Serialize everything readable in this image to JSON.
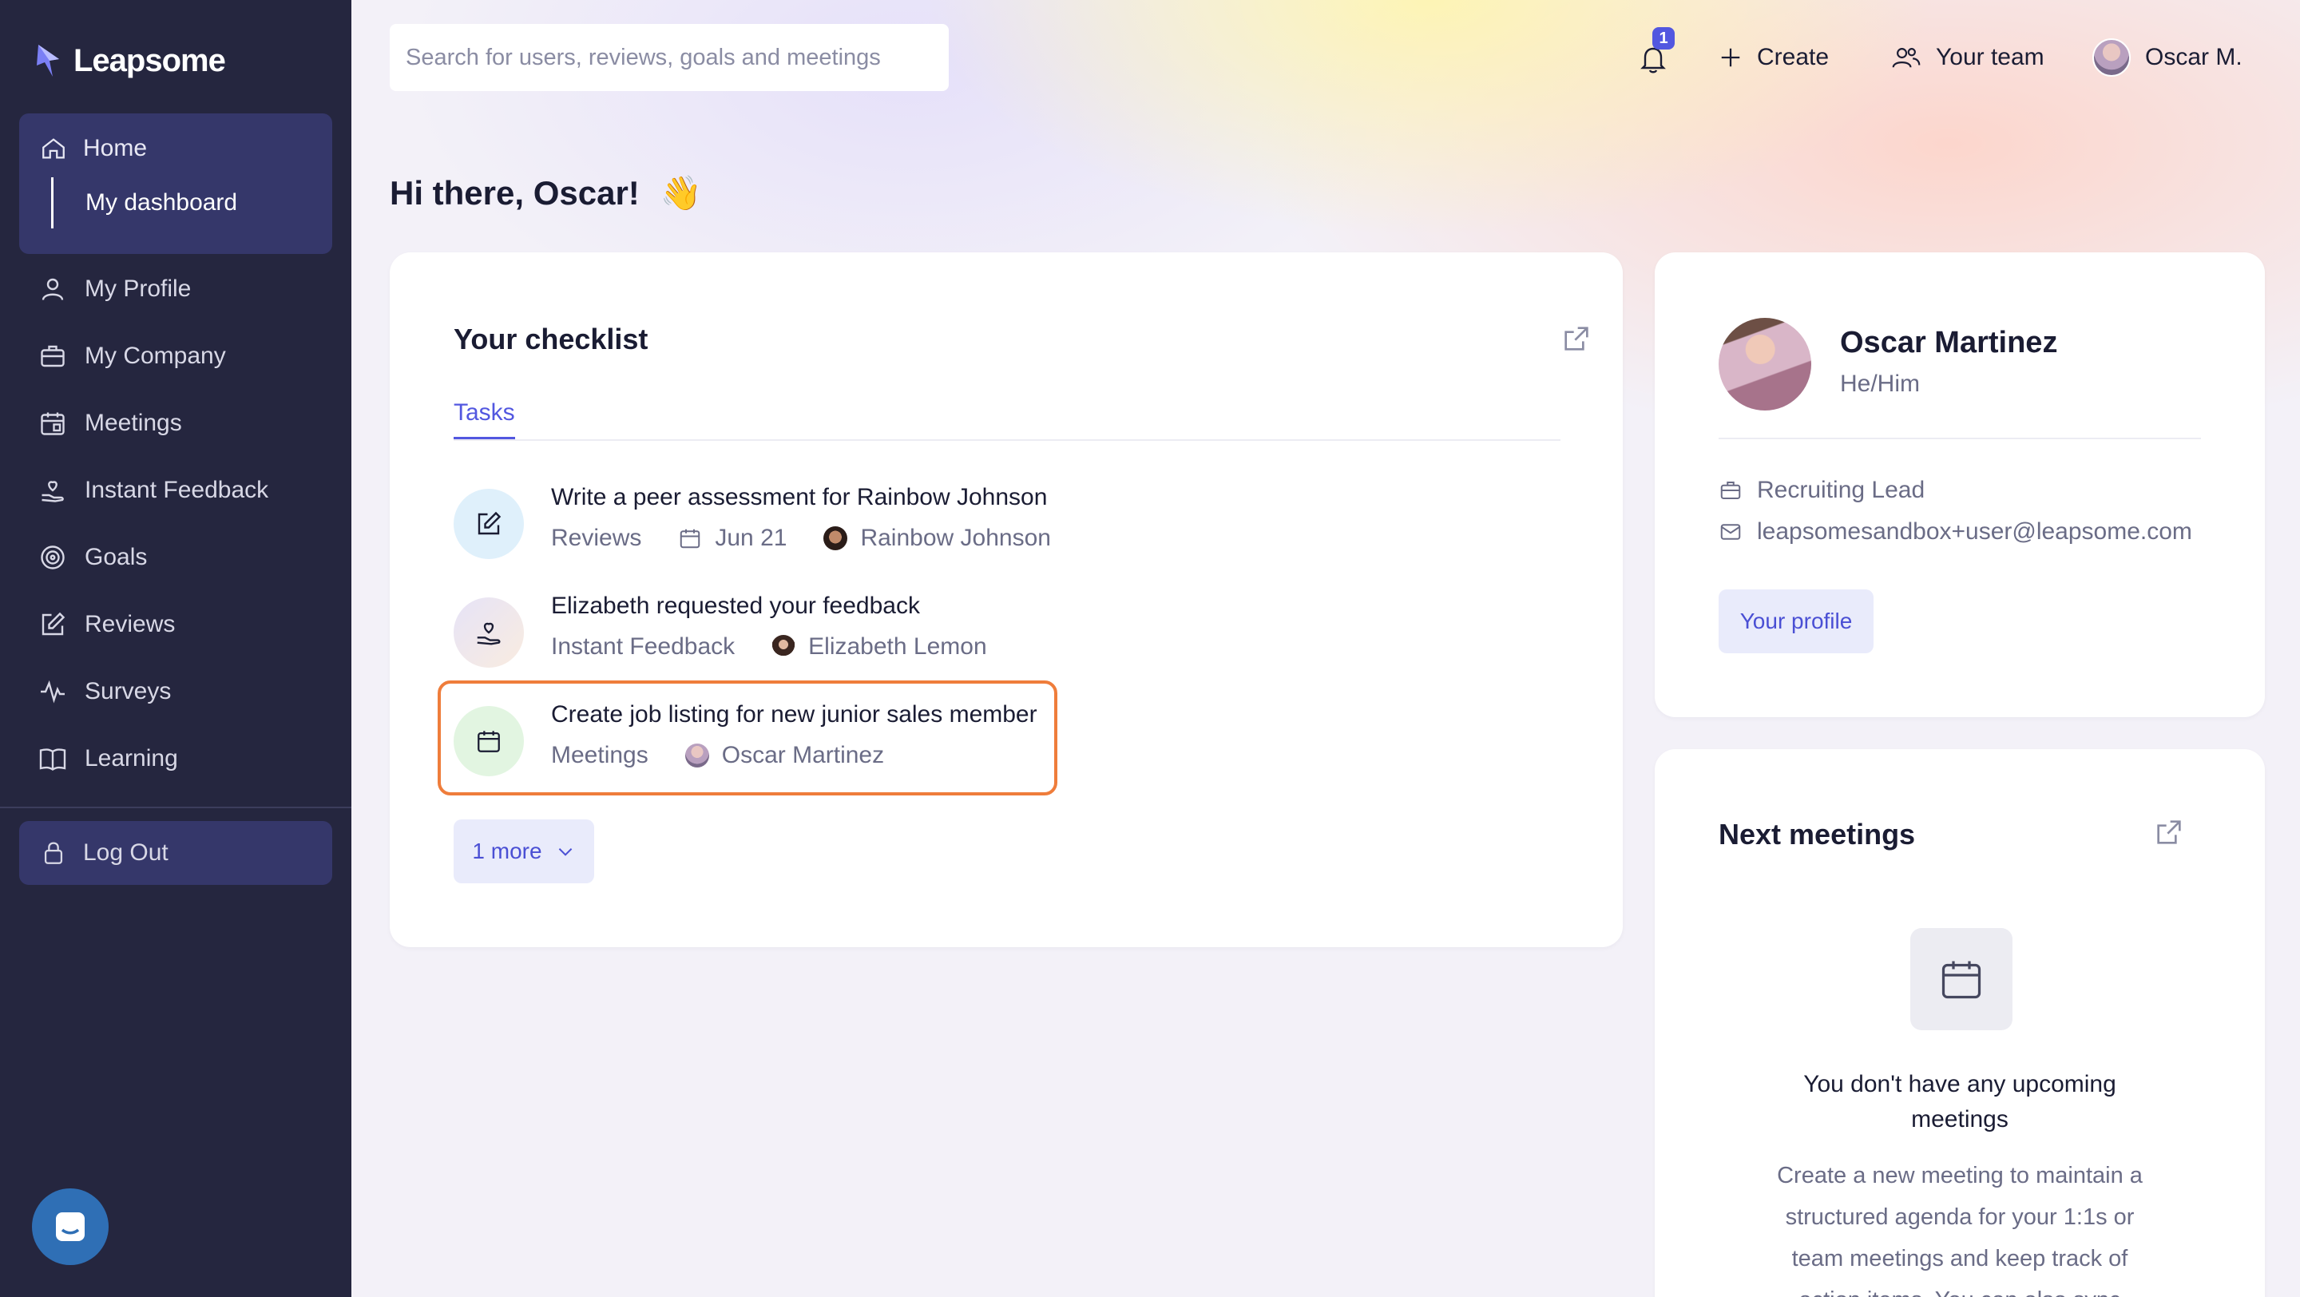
{
  "app": {
    "logo_text": "Leapsome"
  },
  "sidebar": {
    "home": {
      "label": "Home",
      "sub_label": "My dashboard"
    },
    "items": [
      {
        "label": "My Profile",
        "icon": "user-icon"
      },
      {
        "label": "My Company",
        "icon": "briefcase-icon"
      },
      {
        "label": "Meetings",
        "icon": "calendar-icon"
      },
      {
        "label": "Instant Feedback",
        "icon": "hand-heart-icon"
      },
      {
        "label": "Goals",
        "icon": "target-icon"
      },
      {
        "label": "Reviews",
        "icon": "edit-icon"
      },
      {
        "label": "Surveys",
        "icon": "pulse-icon"
      },
      {
        "label": "Learning",
        "icon": "book-icon"
      }
    ],
    "logout_label": "Log Out"
  },
  "header": {
    "search_placeholder": "Search for users, reviews, goals and meetings",
    "notification_count": "1",
    "create_label": "Create",
    "team_label": "Your team",
    "user_label": "Oscar M."
  },
  "greeting": {
    "text": "Hi there, Oscar!",
    "emoji": "👋"
  },
  "checklist": {
    "title": "Your checklist",
    "tab": "Tasks",
    "tasks": [
      {
        "title": "Write a peer assessment for Rainbow Johnson",
        "category": "Reviews",
        "date": "Jun 21",
        "person": "Rainbow Johnson",
        "icon": "edit-icon"
      },
      {
        "title": "Elizabeth requested your feedback",
        "category": "Instant Feedback",
        "person": "Elizabeth Lemon",
        "icon": "hand-heart-icon"
      },
      {
        "title": "Create job listing for new junior sales member",
        "category": "Meetings",
        "person": "Oscar Martinez",
        "icon": "calendar-icon"
      }
    ],
    "more_label": "1 more"
  },
  "profile": {
    "name": "Oscar Martinez",
    "pronouns": "He/Him",
    "role": "Recruiting Lead",
    "email": "leapsomesandbox+user@leapsome.com",
    "button_label": "Your profile"
  },
  "meetings": {
    "title": "Next meetings",
    "empty_title": "You don't have any upcoming meetings",
    "empty_text": "Create a new meeting to maintain a structured agenda for your 1:1s or team meetings and keep track of action items. You can also sync"
  },
  "colors": {
    "sidebar_bg": "#25263f",
    "accent": "#5257e0",
    "highlight": "#ef7d3b"
  }
}
